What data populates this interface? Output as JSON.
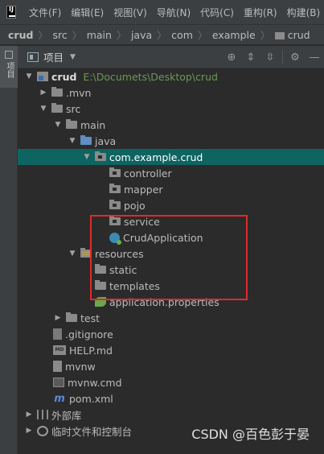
{
  "menu": {
    "items": [
      "文件(F)",
      "编辑(E)",
      "视图(V)",
      "导航(N)",
      "代码(C)",
      "重构(R)",
      "构建(B)"
    ]
  },
  "breadcrumb": [
    "crud",
    "src",
    "main",
    "java",
    "com",
    "example",
    "crud"
  ],
  "sidebar_tab": {
    "label": "项目",
    "icon": "project-icon"
  },
  "project_panel": {
    "title": "项目",
    "toolbar_icons": [
      "locate-icon",
      "expand-all-icon",
      "collapse-all-icon",
      "gear-icon",
      "minimize-icon"
    ]
  },
  "tree": [
    {
      "label": "crud",
      "path": "E:\\Documets\\Desktop\\crud",
      "icon": "module-folder-icon",
      "expanded": true
    },
    {
      "label": ".mvn",
      "icon": "folder-icon",
      "expanded": false
    },
    {
      "label": "src",
      "icon": "folder-icon",
      "expanded": true
    },
    {
      "label": "main",
      "icon": "folder-icon",
      "expanded": true
    },
    {
      "label": "java",
      "icon": "source-folder-icon",
      "expanded": true
    },
    {
      "label": "com.example.crud",
      "icon": "package-icon",
      "expanded": true,
      "selected": true
    },
    {
      "label": "controller",
      "icon": "package-icon"
    },
    {
      "label": "mapper",
      "icon": "package-icon"
    },
    {
      "label": "pojo",
      "icon": "package-icon"
    },
    {
      "label": "service",
      "icon": "package-icon"
    },
    {
      "label": "CrudApplication",
      "icon": "spring-class-icon"
    },
    {
      "label": "resources",
      "icon": "resources-folder-icon",
      "expanded": true
    },
    {
      "label": "static",
      "icon": "folder-icon"
    },
    {
      "label": "templates",
      "icon": "folder-icon"
    },
    {
      "label": "application.properties",
      "icon": "spring-leaf-icon"
    },
    {
      "label": "test",
      "icon": "folder-icon",
      "expanded": false
    },
    {
      "label": ".gitignore",
      "icon": "gitignore-icon"
    },
    {
      "label": "HELP.md",
      "icon": "markdown-icon"
    },
    {
      "label": "mvnw",
      "icon": "file-icon"
    },
    {
      "label": "mvnw.cmd",
      "icon": "cmd-icon"
    },
    {
      "label": "pom.xml",
      "icon": "maven-icon"
    },
    {
      "label": "外部库",
      "icon": "libraries-icon",
      "expanded": false
    },
    {
      "label": "临时文件和控制台",
      "icon": "scratches-icon",
      "expanded": false
    }
  ],
  "watermark": "CSDN @百色彭于晏",
  "colors": {
    "selection": "#0d6461",
    "highlight_box": "#e02a2a",
    "path_text": "#6a9955"
  }
}
